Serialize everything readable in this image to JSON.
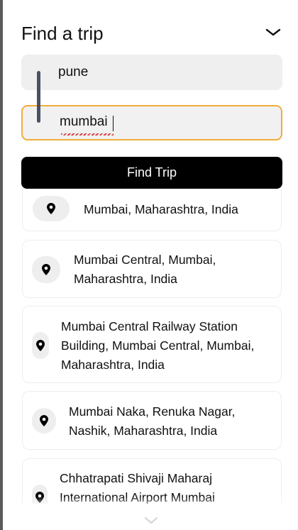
{
  "header": {
    "title": "Find a trip"
  },
  "search": {
    "from_value": "pune",
    "to_value": "mumbai",
    "find_button_label": "Find Trip"
  },
  "suggestions": [
    {
      "lines": [
        "Mumbai, Maharashtra, India"
      ]
    },
    {
      "lines": [
        "Mumbai Central, Mumbai,",
        "Maharashtra, India"
      ]
    },
    {
      "lines": [
        "Mumbai Central Railway Station",
        "Building, Mumbai Central, Mumbai,",
        "Maharashtra, India"
      ]
    },
    {
      "lines": [
        "Mumbai Naka, Renuka Nagar,",
        "Nashik, Maharashtra, India"
      ]
    },
    {
      "lines": [
        "Chhatrapati Shivaji Maharaj",
        "International Airport Mumbai"
      ]
    }
  ],
  "icons": {
    "collapse": "chevron-down-icon",
    "location": "location-pin-icon",
    "scroll": "chevron-down-icon"
  },
  "colors": {
    "accent_border": "#f0ad3b",
    "button_bg": "#000000",
    "input_bg": "#efefef"
  }
}
